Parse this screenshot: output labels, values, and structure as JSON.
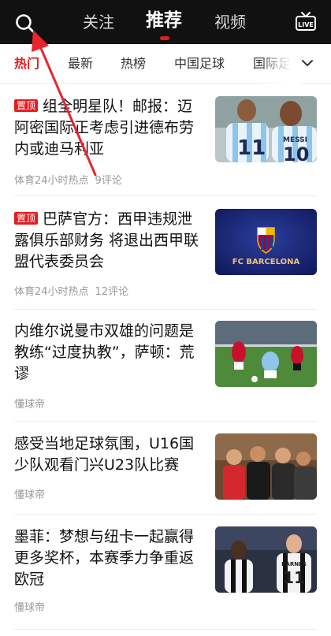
{
  "topbar": {
    "tabs": [
      {
        "label": "关注"
      },
      {
        "label": "推荐"
      },
      {
        "label": "视频"
      }
    ],
    "live_label": "LIVE"
  },
  "categories": [
    {
      "label": "热门"
    },
    {
      "label": "最新"
    },
    {
      "label": "热榜"
    },
    {
      "label": "中国足球"
    },
    {
      "label": "国际足"
    }
  ],
  "news": [
    {
      "badge": "置顶",
      "title": "组全明星队！邮报：迈阿密国际正考虑引进德布劳内或迪马利亚",
      "source": "体育24小时热点",
      "comments": "9评论",
      "thumb_text_left": "11",
      "thumb_text_right": "MESSI",
      "thumb_text_right_num": "10"
    },
    {
      "badge": "置顶",
      "title": "巴萨官方：西甲违规泄露俱乐部财务 将退出西甲联盟代表委员会",
      "source": "体育24小时热点",
      "comments": "12评论",
      "thumb_text": "FC BARCELONA"
    },
    {
      "title": "内维尔说曼市双雄的问题是教练“过度执教”，萨顿：荒谬",
      "source": "懂球帝"
    },
    {
      "title": "感受当地足球氛围，U16国少队观看门兴U23队比赛",
      "source": "懂球帝"
    },
    {
      "title": "墨菲：梦想与纽卡一起赢得更多奖杯，本赛季力争重返欧冠",
      "source": "懂球帝",
      "thumb_text": "BARNES",
      "thumb_num": "11"
    }
  ],
  "colors": {
    "accent": "#e51b22",
    "topbar": "#111111"
  }
}
